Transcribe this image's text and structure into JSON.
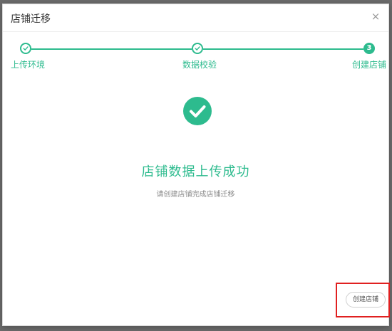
{
  "modal": {
    "title": "店铺迁移",
    "close_glyph": "×"
  },
  "steps": [
    {
      "label": "上传环境",
      "status": "done"
    },
    {
      "label": "数据校验",
      "status": "done"
    },
    {
      "label": "创建店铺",
      "status": "current",
      "number": "3"
    }
  ],
  "result": {
    "title": "店铺数据上传成功",
    "subtitle": "请创建店铺完成店铺迁移",
    "icon": "check-circle-icon"
  },
  "actions": {
    "create_label": "创建店铺"
  },
  "colors": {
    "accent": "#2dbb8e",
    "highlight": "#e02020"
  }
}
